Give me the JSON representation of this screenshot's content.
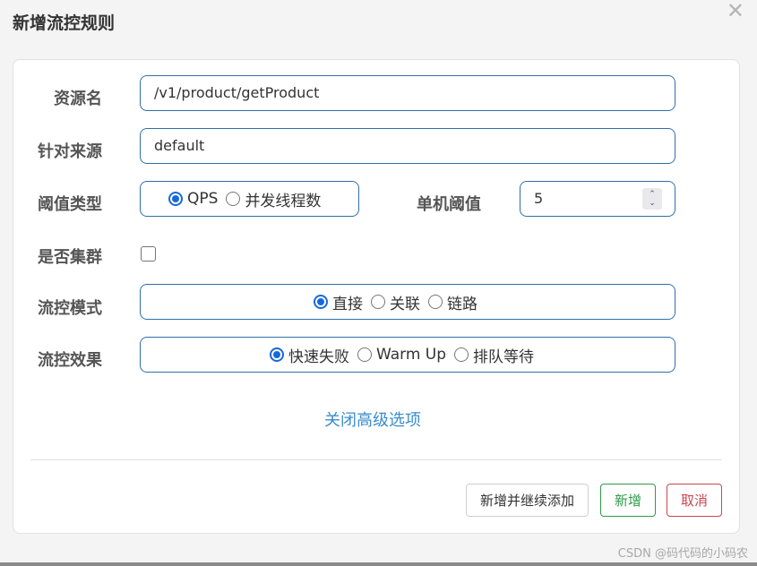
{
  "dialog": {
    "title": "新增流控规则",
    "close_icon": "close-icon"
  },
  "form": {
    "resource": {
      "label": "资源名",
      "value": "/v1/product/getProduct"
    },
    "source": {
      "label": "针对来源",
      "value": "default"
    },
    "threshold_type": {
      "label": "阈值类型",
      "options": [
        "QPS",
        "并发线程数"
      ],
      "selected": "QPS"
    },
    "single_threshold": {
      "label": "单机阈值",
      "value": "5"
    },
    "cluster": {
      "label": "是否集群",
      "checked": false
    },
    "flow_mode": {
      "label": "流控模式",
      "options": [
        "直接",
        "关联",
        "链路"
      ],
      "selected": "直接"
    },
    "flow_effect": {
      "label": "流控效果",
      "options": [
        "快速失败",
        "Warm Up",
        "排队等待"
      ],
      "selected": "快速失败"
    }
  },
  "advanced_link": "关闭高级选项",
  "buttons": {
    "continue": "新增并继续添加",
    "add": "新增",
    "cancel": "取消"
  },
  "watermark": "CSDN @码代码的小码农",
  "colors": {
    "accent": "#1769d9",
    "border": "#2f6fa8",
    "link": "#3b8ccc",
    "success": "#2e9a4a",
    "danger": "#c9464f"
  }
}
